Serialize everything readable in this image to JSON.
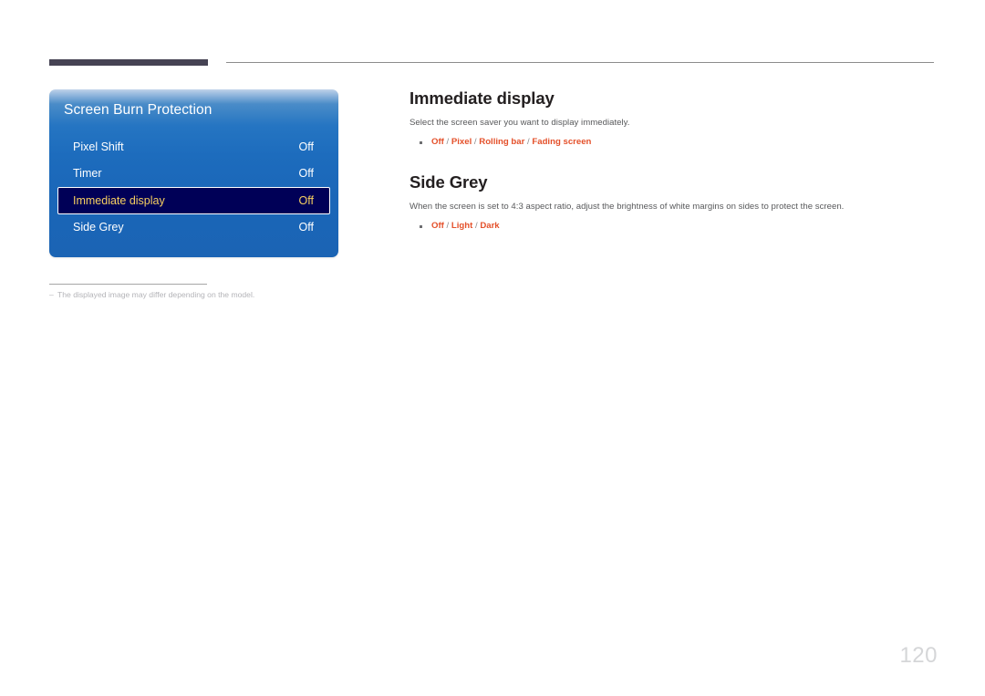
{
  "header": {
    "bar_color": "#464354",
    "rule_color": "#8c8c8c"
  },
  "osd": {
    "title": "Screen Burn Protection",
    "panel_color": "#1b64b4",
    "highlight_bg": "#000057",
    "highlight_text": "#f6cf60",
    "rows": [
      {
        "label": "Pixel Shift",
        "value": "Off",
        "selected": false
      },
      {
        "label": "Timer",
        "value": "Off",
        "selected": false
      },
      {
        "label": "Immediate display",
        "value": "Off",
        "selected": true
      },
      {
        "label": "Side Grey",
        "value": "Off",
        "selected": false
      }
    ]
  },
  "footnote": {
    "dash": "–",
    "text": "The displayed image may differ depending on the model."
  },
  "content": {
    "accent_color": "#e4502a",
    "sections": [
      {
        "heading": "Immediate display",
        "description": "Select the screen saver you want to display immediately.",
        "options": [
          "Off",
          "Pixel",
          "Rolling bar",
          "Fading screen"
        ]
      },
      {
        "heading": "Side Grey",
        "description": "When the screen is set to 4:3 aspect ratio, adjust the brightness of white margins on sides to protect the screen.",
        "options": [
          "Off",
          "Light",
          "Dark"
        ]
      }
    ]
  },
  "page_number": "120"
}
